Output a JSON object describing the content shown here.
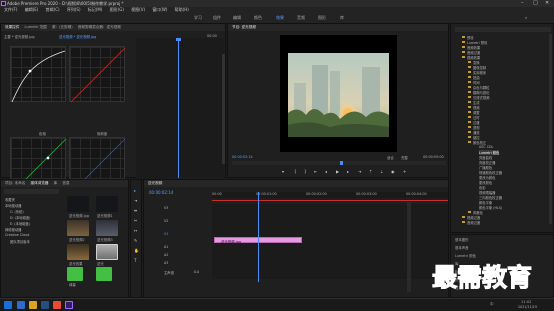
{
  "window": {
    "title": "Adobe Premiere Pro 2020 - D:\\视频\\8\\00\\5\\制作教学.prproj *",
    "controls": [
      "–",
      "□",
      "✕"
    ]
  },
  "menu": [
    "文件(F)",
    "编辑(E)",
    "剪辑(C)",
    "序列(S)",
    "标记(M)",
    "图形(G)",
    "视图(V)",
    "窗口(W)",
    "帮助(H)"
  ],
  "workspaces": {
    "items": [
      "学习",
      "组件",
      "编辑",
      "颜色",
      "效果",
      "音频",
      "图形",
      "库"
    ],
    "active": "效果"
  },
  "source_panel": {
    "tabs": [
      "效果控件",
      "Lumetri 范围",
      "源：(无剪辑)",
      "音频剪辑混合器：逆光视频"
    ],
    "header_left": "主要 * 逆光视频.jpg",
    "header_right": "逆光视频 * 逆光视频.jpg",
    "time": "00:00",
    "curve_labels": [
      "色相",
      "饱和度",
      "亮度"
    ]
  },
  "program_monitor": {
    "tab": "节目: 逆光视频",
    "timecode_left": "00:00:02:14",
    "fit": "适合",
    "quality": "完整",
    "timecode_right": "00:00:05:00"
  },
  "effects_tree": {
    "items": [
      "预设",
      "Lumetri 预设",
      "音频效果",
      "音频过渡",
      "视频效果",
      "变换",
      "图像控制",
      "实用程序",
      "扭曲",
      "时间",
      "杂色与颗粒",
      "模糊与锐化",
      "沉浸式视频",
      "生成",
      "视频",
      "调整",
      "过时",
      "过渡",
      "透视",
      "通道",
      "键控",
      "颜色校正",
      "ASC CDL",
      "Lumetri 颜色",
      "亮度曲线",
      "亮度校正器",
      "广播颜色",
      "快速颜色校正器",
      "更改为颜色",
      "更改颜色",
      "色彩",
      "视频限幅器",
      "三向颜色校正器",
      "颜色平衡",
      "颜色平衡 (HLS)",
      "风格化",
      "视频过渡",
      "音频过渡"
    ],
    "panel2": [
      "基本图形",
      "基本声音",
      "Lumetri 颜色",
      "库",
      "标记",
      "历史记录",
      "信息"
    ]
  },
  "project_panel": {
    "tabs": [
      "项目: 未命名",
      "媒体浏览器",
      "库",
      "信息"
    ],
    "search_placeholder": "",
    "tree": [
      "收藏夹",
      "本地驱动器",
      "C: (系统)",
      "D: (本地磁盘)",
      "E: (本地磁盘)",
      "网络驱动器",
      "Creative Cloud",
      "团队项目版本"
    ],
    "thumbs": [
      "逆光视频.jpg",
      "逆光视频1",
      "逆光视频2",
      "逆光视频3",
      "逆光效果",
      "逆光",
      "绿幕"
    ]
  },
  "timeline": {
    "tab": "逆光视频",
    "timecode": "00:00:02:14",
    "tracks": [
      "V3",
      "V2",
      "V1",
      "A1",
      "A2",
      "A3",
      "主声道"
    ],
    "clip": "逆光视频.jpg",
    "master_value": "0.0",
    "ruler": [
      "00:00",
      "00:00:01:00",
      "00:00:02:00",
      "00:00:03:00",
      "00:00:04:00"
    ]
  },
  "taskbar": {
    "time": "11:02",
    "date": "2021/11/19",
    "lang": "中"
  },
  "watermark": {
    "text": "最需教育",
    "color": "#1b3aa8"
  },
  "colors": {
    "accent": "#5aa0ff",
    "clip": "#e59ae3",
    "playhead": "#4c8cf5"
  }
}
